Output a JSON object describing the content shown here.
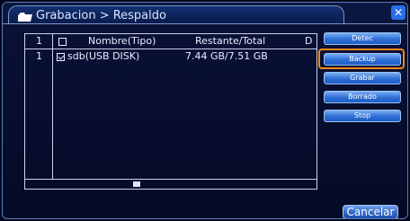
{
  "window": {
    "title": "Grabacion > Respaldo",
    "close_glyph": "✕"
  },
  "table": {
    "headers": {
      "index": "1",
      "name": "Nombre(Tipo)",
      "remaining": "Restante/Total",
      "extra": "D"
    },
    "rows": [
      {
        "index": "1",
        "name": "sdb(USB DISK)",
        "remaining": "7.44 GB/7.51 GB",
        "checked": true
      }
    ]
  },
  "buttons": {
    "detect": "Detec",
    "backup": "Backup",
    "record": "Grabar",
    "erase": "Borrado",
    "stop": "Stop",
    "cancel": "Cancelar"
  },
  "colors": {
    "background": "#02061b",
    "button": "#2e6fd6",
    "focus": "#f08a1c"
  }
}
